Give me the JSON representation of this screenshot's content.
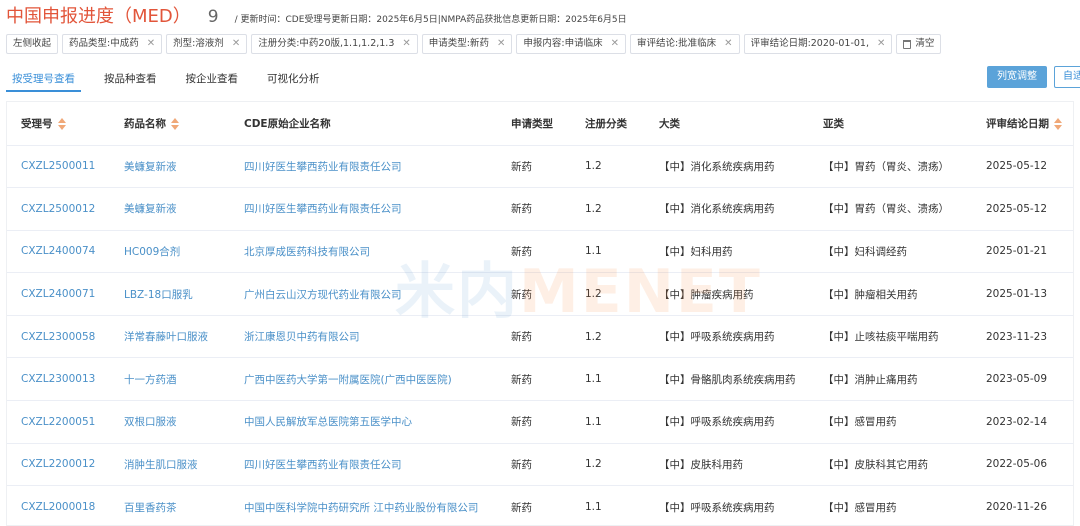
{
  "header": {
    "title": "中国申报进度（MED）",
    "count": "9",
    "updated": "/ 更新时间：CDE受理号更新日期：2025年6月5日|NMPA药品获批信息更新日期：2025年6月5日"
  },
  "filters": {
    "collapse_label": "左侧收起",
    "chips": [
      "药品类型:中成药",
      "剂型:溶液剂",
      "注册分类:中药20版,1.1,1.2,1.3",
      "申请类型:新药",
      "申报内容:申请临床",
      "审评结论:批准临床",
      "评审结论日期:2020-01-01,"
    ],
    "clear_label": "清空"
  },
  "tabs": [
    "按受理号查看",
    "按品种查看",
    "按企业查看",
    "可视化分析"
  ],
  "buttons": {
    "columns": "列宽调整",
    "auto": "自适应"
  },
  "table": {
    "headers": [
      "受理号",
      "药品名称",
      "CDE原始企业名称",
      "申请类型",
      "注册分类",
      "大类",
      "亚类",
      "评审结论日期"
    ],
    "rows": [
      [
        "CXZL2500011",
        "美蠊复新液",
        "四川好医生攀西药业有限责任公司",
        "新药",
        "1.2",
        "【中】消化系统疾病用药",
        "【中】胃药（胃炎、溃疡）",
        "2025-05-12"
      ],
      [
        "CXZL2500012",
        "美蠊复新液",
        "四川好医生攀西药业有限责任公司",
        "新药",
        "1.2",
        "【中】消化系统疾病用药",
        "【中】胃药（胃炎、溃疡）",
        "2025-05-12"
      ],
      [
        "CXZL2400074",
        "HC009合剂",
        "北京厚成医药科技有限公司",
        "新药",
        "1.1",
        "【中】妇科用药",
        "【中】妇科调经药",
        "2025-01-21"
      ],
      [
        "CXZL2400071",
        "LBZ-18口服乳",
        "广州白云山汉方现代药业有限公司",
        "新药",
        "1.2",
        "【中】肿瘤疾病用药",
        "【中】肿瘤相关用药",
        "2025-01-13"
      ],
      [
        "CXZL2300058",
        "洋常春藤叶口服液",
        "浙江康恩贝中药有限公司",
        "新药",
        "1.2",
        "【中】呼吸系统疾病用药",
        "【中】止咳祛痰平喘用药",
        "2023-11-23"
      ],
      [
        "CXZL2300013",
        "十一方药酒",
        "广西中医药大学第一附属医院(广西中医医院)",
        "新药",
        "1.1",
        "【中】骨骼肌肉系统疾病用药",
        "【中】消肿止痛用药",
        "2023-05-09"
      ],
      [
        "CXZL2200051",
        "双根口服液",
        "中国人民解放军总医院第五医学中心",
        "新药",
        "1.1",
        "【中】呼吸系统疾病用药",
        "【中】感冒用药",
        "2023-02-14"
      ],
      [
        "CXZL2200012",
        "消肿生肌口服液",
        "四川好医生攀西药业有限责任公司",
        "新药",
        "1.2",
        "【中】皮肤科用药",
        "【中】皮肤科其它用药",
        "2022-05-06"
      ],
      [
        "CXZL2000018",
        "百里香药茶",
        "中国中医科学院中药研究所 江中药业股份有限公司",
        "新药",
        "1.1",
        "【中】呼吸系统疾病用药",
        "【中】感冒用药",
        "2020-11-26"
      ]
    ]
  },
  "watermark": {
    "cn": "米内",
    "en": "MENET"
  },
  "colors": {
    "title": "#e2553a",
    "link": "#4a90c8",
    "accent": "#3a8fd8",
    "button": "#5ba3d9"
  }
}
